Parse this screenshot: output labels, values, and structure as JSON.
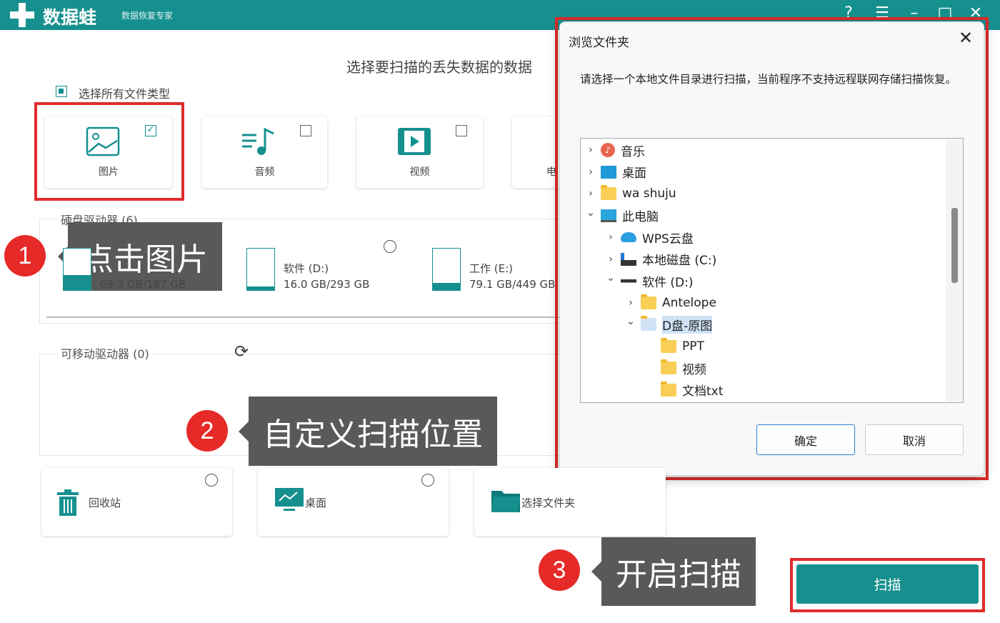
{
  "app": {
    "name": "数据蛙",
    "tagline": "数据恢复专家",
    "icons": [
      "help-icon",
      "menu-icon",
      "minimize-icon",
      "maximize-icon",
      "close-icon"
    ]
  },
  "main": {
    "title": "选择要扫描的丢失数据的数据",
    "select_all_label": "选择所有文件类型",
    "select_all_checked": true
  },
  "file_types": [
    {
      "label": "图片",
      "icon": "image-icon",
      "checked": true
    },
    {
      "label": "音频",
      "icon": "audio-icon",
      "checked": false
    },
    {
      "label": "视频",
      "icon": "video-icon",
      "checked": false
    },
    {
      "label": "电",
      "icon": "document-icon",
      "checked": false
    }
  ],
  "hard_drives": {
    "label": "硬盘驱动器",
    "count": "(6)",
    "items": [
      {
        "name": "",
        "size": "69.3 GB/187 GB",
        "used_fraction": 0.37
      },
      {
        "name": "软件 (D:)",
        "size": "16.0 GB/293 GB",
        "used_fraction": 0.05
      },
      {
        "name": "工作 (E:)",
        "size": "79.1 GB/449 GB",
        "used_fraction": 0.18
      }
    ]
  },
  "removable_drives": {
    "label": "可移动驱动器",
    "count": "(0)",
    "refresh_icon": "refresh-icon"
  },
  "locations": [
    {
      "label": "回收站",
      "icon": "recycle-bin-icon"
    },
    {
      "label": "桌面",
      "icon": "desktop-icon"
    },
    {
      "label": "选择文件夹",
      "icon": "folder-icon"
    }
  ],
  "callouts": [
    {
      "number": "1",
      "text": "点击图片"
    },
    {
      "number": "2",
      "text": "自定义扫描位置"
    },
    {
      "number": "3",
      "text": "开启扫描"
    }
  ],
  "scan_button": "扫描",
  "dialog": {
    "title": "浏览文件夹",
    "description": "请选择一个本地文件目录进行扫描，当前程序不支持远程联网存储扫描恢复。",
    "ok": "确定",
    "cancel": "取消",
    "tree": [
      {
        "label": "音乐",
        "level": 0,
        "state": "collapsed",
        "icon": "music"
      },
      {
        "label": "桌面",
        "level": 0,
        "state": "collapsed",
        "icon": "desktop"
      },
      {
        "label": "wa shuju",
        "level": 0,
        "state": "collapsed",
        "icon": "folder"
      },
      {
        "label": "此电脑",
        "level": 0,
        "state": "expanded",
        "icon": "pc"
      },
      {
        "label": "WPS云盘",
        "level": 1,
        "state": "collapsed",
        "icon": "cloud"
      },
      {
        "label": "本地磁盘 (C:)",
        "level": 1,
        "state": "collapsed",
        "icon": "disk"
      },
      {
        "label": "软件 (D:)",
        "level": 1,
        "state": "expanded",
        "icon": "drive"
      },
      {
        "label": "Antelope",
        "level": 2,
        "state": "collapsed",
        "icon": "folder"
      },
      {
        "label": "D盘-原图",
        "level": 2,
        "state": "expanded",
        "icon": "folder",
        "selected": true
      },
      {
        "label": "PPT",
        "level": 3,
        "state": "none",
        "icon": "folder"
      },
      {
        "label": "视频",
        "level": 3,
        "state": "none",
        "icon": "folder"
      },
      {
        "label": "文档txt",
        "level": 3,
        "state": "none",
        "icon": "folder"
      }
    ]
  },
  "colors": {
    "brand": "#16908f",
    "highlight": "#e02b2b",
    "callout_bg": "#595959",
    "selection": "#cfe3f5"
  }
}
